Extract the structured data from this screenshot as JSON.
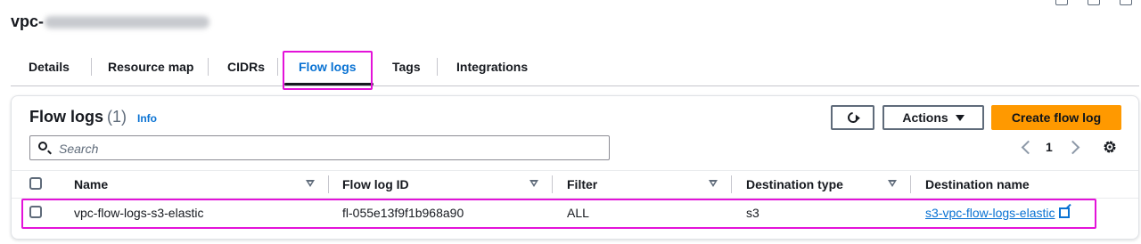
{
  "header": {
    "vpc_prefix": "vpc-"
  },
  "tabs": [
    {
      "label": "Details"
    },
    {
      "label": "Resource map"
    },
    {
      "label": "CIDRs"
    },
    {
      "label": "Flow logs",
      "active": true
    },
    {
      "label": "Tags"
    },
    {
      "label": "Integrations"
    }
  ],
  "panel": {
    "title": "Flow logs",
    "count": "(1)",
    "info": "Info",
    "actions_label": "Actions",
    "create_label": "Create flow log",
    "search_placeholder": "Search",
    "page": "1"
  },
  "table": {
    "columns": [
      "Name",
      "Flow log ID",
      "Filter",
      "Destination type",
      "Destination name"
    ],
    "rows": [
      {
        "name": "vpc-flow-logs-s3-elastic",
        "flow_log_id": "fl-055e13f9f1b968a90",
        "filter": "ALL",
        "destination_type": "s3",
        "destination_name": "s3-vpc-flow-logs-elastic"
      }
    ]
  },
  "colors": {
    "accent": "#0972d3",
    "primary_button": "#ff9900",
    "highlight": "#e313d9"
  }
}
